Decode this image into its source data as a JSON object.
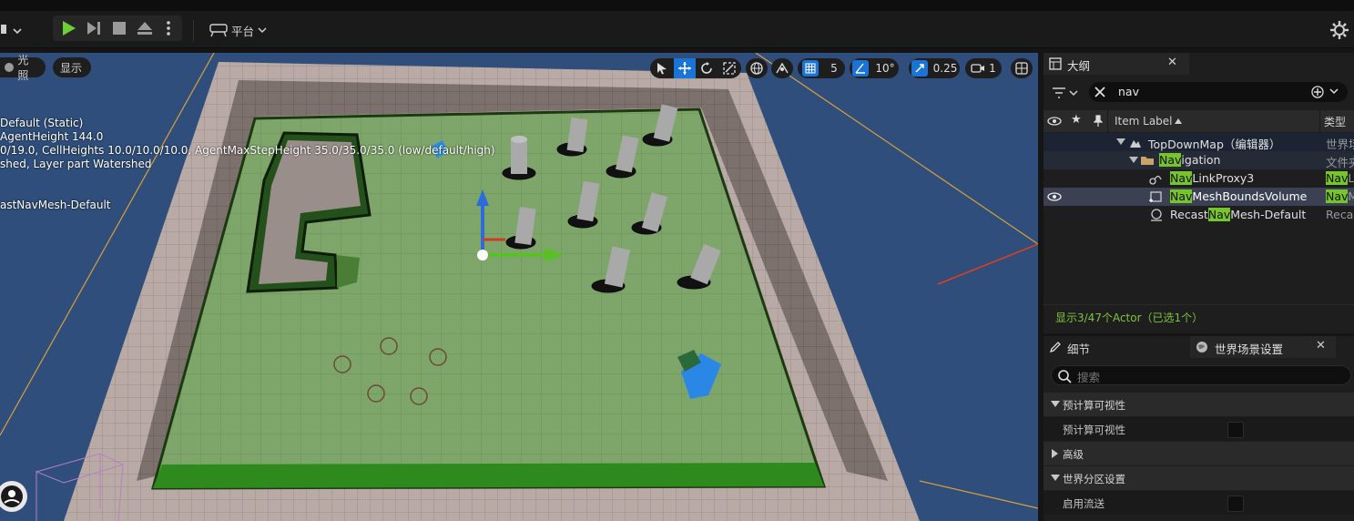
{
  "toolbar": {
    "platform_label": "平台"
  },
  "viewport": {
    "lit_label": "光照",
    "show_label": "显示",
    "grid_snap": "5",
    "rotation_snap": "10°",
    "scale_snap": "0.25",
    "camera_speed": "1",
    "stats": [
      "Default (Static)",
      "AgentHeight 144.0",
      "0/19.0, CellHeights 10.0/10.0/10.0, AgentMaxStepHeight 35.0/35.0/35.0 (low/default/high)",
      "shed, Layer part Watershed",
      "astNavMesh-Default"
    ]
  },
  "outliner": {
    "tab_label": "大纲",
    "search_value": "nav",
    "col_item_label": "Item Label",
    "col_type": "类型",
    "rows": [
      {
        "pre": "TopDownMap（编辑器）",
        "hl": "",
        "post": "",
        "type": "世界场"
      },
      {
        "pre": "",
        "hl": "Nav",
        "post": "igation",
        "type": "文件夹"
      },
      {
        "pre": "",
        "hl": "Nav",
        "post": "LinkProxy3",
        "type_hl": "Nav",
        "type": "L"
      },
      {
        "pre": "",
        "hl": "Nav",
        "post": "MeshBoundsVolume",
        "type_hl": "Nav",
        "type": "M"
      },
      {
        "pre": "Recast",
        "hl": "Nav",
        "post": "Mesh-Default",
        "type": "Recas"
      }
    ],
    "footer": "显示3/47个Actor（已选1个）"
  },
  "details": {
    "tab_details": "细节",
    "tab_world": "世界场景设置",
    "search_placeholder": "搜索",
    "cat_precompute": "预计算可视性",
    "prop_precompute": "预计算可视性",
    "cat_advanced": "高级",
    "cat_world_partition": "世界分区设置",
    "prop_streaming": "启用流送"
  },
  "colors": {
    "accent_blue": "#1a74d8",
    "highlight_green": "#76c52a",
    "footer_green": "#7ec43a",
    "annotation_red": "#e0401c"
  }
}
